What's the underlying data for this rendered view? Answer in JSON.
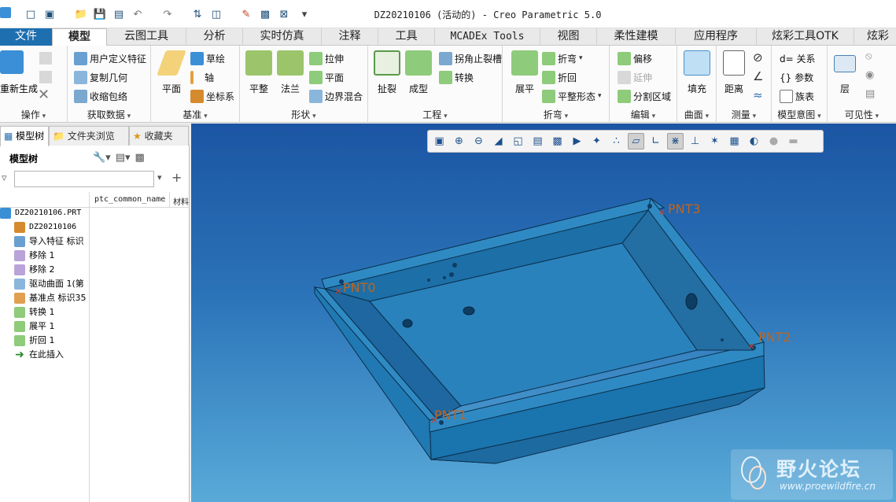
{
  "window": {
    "title": "DZ20210106 (活动的) - Creo Parametric 5.0"
  },
  "tabs": [
    "文件",
    "模型",
    "云图工具",
    "分析",
    "实时仿真",
    "注释",
    "工具",
    "MCADEx Tools",
    "视图",
    "柔性建模",
    "应用程序",
    "炫彩工具OTK",
    "炫彩"
  ],
  "active_tab": "模型",
  "ribbon": {
    "groups": [
      "操作",
      "获取数据",
      "基准",
      "形状",
      "工程",
      "折弯",
      "编辑",
      "曲面",
      "测量",
      "模型意图",
      "可见性"
    ],
    "regen_label": "重新生成",
    "get_data": {
      "udf": "用户定义特征",
      "copy_geom": "复制几何",
      "shrinkwrap": "收缩包络"
    },
    "datum": {
      "plane": "平面",
      "sketch": "草绘",
      "axis": "轴",
      "csys": "坐标系"
    },
    "shape": {
      "flat": "平整",
      "flange": "法兰",
      "extrude": "拉伸",
      "plane": "平面",
      "blend": "边界混合"
    },
    "engineering": {
      "rip": "扯裂",
      "form": "成型",
      "corner_relief": "拐角止裂槽",
      "convert": "转换"
    },
    "bend": {
      "unbend": "展平",
      "bend": "折弯",
      "bend_back": "折回",
      "flat_state": "平整形态"
    },
    "edit": {
      "offset": "偏移",
      "extend": "延伸",
      "split_area": "分割区域"
    },
    "surface": {
      "fill": "填充"
    },
    "measure": {
      "distance": "距离"
    },
    "intent": {
      "relations": "d= 关系",
      "params": "{} 参数",
      "family": "族表"
    },
    "visibility": {
      "layer": "层"
    }
  },
  "panel": {
    "tabs": [
      "模型树",
      "文件夹浏览",
      "收藏夹"
    ],
    "tree_title": "模型树",
    "columns": [
      "ptc_common_name",
      "材料"
    ],
    "nodes": [
      {
        "label": "DZ20210106.PRT",
        "icon": "part-icon",
        "mono": true
      },
      {
        "label": "DZ20210106",
        "icon": "csys-icon",
        "mono": true
      },
      {
        "label": "导入特征 标识",
        "icon": "import-feature-icon"
      },
      {
        "label": "移除 1",
        "icon": "remove-icon"
      },
      {
        "label": "移除 2",
        "icon": "remove-icon"
      },
      {
        "label": "驱动曲面 1(第",
        "icon": "driving-surface-icon"
      },
      {
        "label": "基准点 标识35",
        "icon": "datum-point-icon"
      },
      {
        "label": "转换 1",
        "icon": "convert-icon"
      },
      {
        "label": "展平 1",
        "icon": "unbend-icon"
      },
      {
        "label": "折回 1",
        "icon": "bend-back-icon"
      },
      {
        "label": "在此插入",
        "icon": "insert-here-icon"
      }
    ]
  },
  "viewport": {
    "points": [
      "PNT0",
      "PNT1",
      "PNT2",
      "PNT3"
    ],
    "watermark": {
      "name": "野火论坛",
      "url": "www.proewildfire.cn"
    }
  }
}
